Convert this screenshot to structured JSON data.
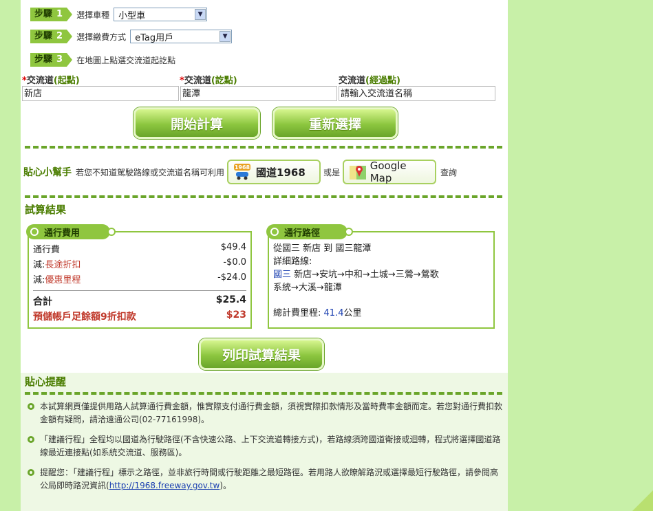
{
  "steps": [
    {
      "badge": "步驟",
      "num": "1",
      "text": "選擇車種",
      "select": "小型車"
    },
    {
      "badge": "步驟",
      "num": "2",
      "text": "選擇繳費方式",
      "select": "eTag用戶"
    },
    {
      "badge": "步驟",
      "num": "3",
      "text": "在地圖上點選交流道起訖點"
    }
  ],
  "fields": {
    "start": {
      "label": "交流道",
      "paren": "(起點)",
      "value": "新店"
    },
    "end": {
      "label": "交流道",
      "paren": "(訖點)",
      "value": "龍潭"
    },
    "via": {
      "label": "交流道",
      "paren": "(經過點)",
      "value": "請輸入交流道名稱"
    }
  },
  "buttons": {
    "calc": "開始計算",
    "reset": "重新選擇",
    "print": "列印試算結果"
  },
  "helper": {
    "title": "貼心小幫手",
    "text": "若您不知道駕駛路線或交流道名稱可利用",
    "or": "或是",
    "query": "查詢",
    "chip1": "國道1968",
    "chip1_icon_text": "1968",
    "chip2": "Google Map"
  },
  "results_title": "試算結果",
  "fee": {
    "tab": "通行費用",
    "rows": [
      {
        "label": "通行費",
        "prefix": "",
        "value": "$49.4"
      },
      {
        "label": "長途折扣",
        "prefix": "減:",
        "value": "-$0.0"
      },
      {
        "label": "優惠里程",
        "prefix": "減:",
        "value": "-$24.0"
      }
    ],
    "total_label": "合計",
    "total_value": "$25.4",
    "prepaid_label": "預儲帳戶足餘額9折扣款",
    "prepaid_value": "$23"
  },
  "route": {
    "tab": "通行路徑",
    "line1": "從國三 新店 到 國三龍潭",
    "line2": "詳細路線:",
    "highway": "國三",
    "path1": " 新店→安坑→中和→土城→三鶯→鶯歌",
    "path2": "系統→大溪→龍潭",
    "total_label": "總計費里程:",
    "total_value": "41.4",
    "total_unit": "公里"
  },
  "tips": {
    "title": "貼心提醒",
    "items": [
      "本試算網頁僅提供用路人試算通行費金額，惟實際支付通行費金額，須視實際扣款情形及當時費率金額而定。若您對通行費扣款金額有疑問，請洽遠通公司(02-77161998)。",
      "「建議行程」全程均以國道為行駛路徑(不含快速公路、上下交流道轉接方式)，若路線須跨國道衛接或迴轉，程式將選擇國道路線最近連接點(如系統交流道、服務區)。"
    ],
    "item3_text": "提醒您：「建議行程」標示之路徑，並非旅行時間或行駛距離之最短路徑。若用路人欲瞭解路況或選擇最短行駛路徑，請參閱高公局即時路況資訊(",
    "item3_link": "http://1968.freeway.gov.tw",
    "item3_end": ")。"
  }
}
